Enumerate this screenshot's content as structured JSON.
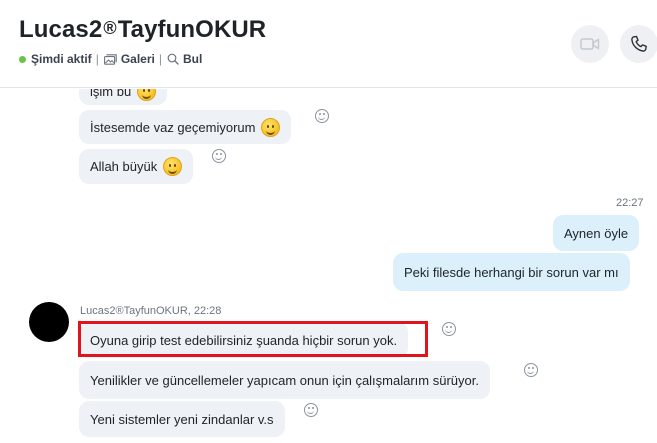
{
  "header": {
    "title_part1": "Lucas2",
    "title_reg": "®",
    "title_part2": "TayfunOKUR",
    "status": "Şimdi aktif",
    "separator": "|",
    "gallery": "Galeri",
    "search": "Bul"
  },
  "messages": {
    "in1": "işim bu",
    "in2": "İstesemde vaz geçemiyorum",
    "in3": "Allah büyük",
    "out_time": "22:27",
    "out1": "Aynen öyle",
    "out2": "Peki filesde herhangi bir sorun var mı",
    "sender_line": "Lucas2®TayfunOKUR, 22:28",
    "in4": "Oyuna girip test edebilirsiniz şuanda hiçbir sorun yok.",
    "in5": "Yenilikler ve güncellemeler yapıcam onun için çalışmalarım sürüyor.",
    "in6": "Yeni sistemler yeni zindanlar v.s"
  },
  "colors": {
    "online": "#6cc24a",
    "incoming_bubble": "#eef1f5",
    "outgoing_bubble": "#dbf0fb",
    "highlight": "#e0141e"
  },
  "icons": [
    "video-call-icon",
    "phone-call-icon",
    "gallery-icon",
    "search-icon",
    "smiley-emoji-icon",
    "add-reaction-icon"
  ]
}
